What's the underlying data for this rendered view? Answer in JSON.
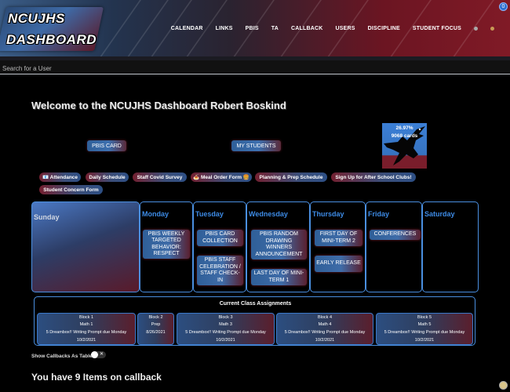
{
  "header": {
    "logo_line1": "NCUJHS",
    "logo_line2": "DASHBOARD",
    "nav": [
      "CALENDAR",
      "LINKS",
      "PBIS",
      "TA",
      "CALLBACK",
      "USERS",
      "DISCIPLINE",
      "STUDENT FOCUS"
    ],
    "corner_badge": "0"
  },
  "search": {
    "placeholder": "Search for a User"
  },
  "welcome": "Welcome to the NCUJHS Dashboard Robert Boskind",
  "buttons": {
    "pbis_card": "PBIS CARD",
    "my_students": "MY STUDENTS"
  },
  "stats": {
    "percent": "26.97%",
    "cards": "9068 cards"
  },
  "pills": [
    "📧 Attendance",
    "Daily Schedule",
    "Staff Covid Survey",
    "🍝 Meal Order Form 🍔",
    "Planning & Prep Schedule",
    "Sign Up for After School Clubs!",
    "Student Concern Form"
  ],
  "calendar": {
    "days": [
      "Sunday",
      "Monday",
      "Tuesday",
      "Wednesday",
      "Thursday",
      "Friday",
      "Saturday"
    ],
    "events": {
      "monday": [
        "PBIS WEEKLY TARGETED BEHAVIOR: RESPECT"
      ],
      "tuesday": [
        "PBIS CARD COLLECTION",
        "PBIS STAFF CELEBRATION / STAFF CHECK-IN"
      ],
      "wednesday": [
        "PBIS RANDOM DRAWING WINNERS ANNOUNCEMENT",
        "LAST DAY OF MINI-TERM 1"
      ],
      "thursday": [
        "FIRST DAY OF MINI-TERM 2",
        "EARLY RELEASE"
      ],
      "friday": [
        "CONFERENCES"
      ]
    }
  },
  "assignments": {
    "title": "Current Class Assignments",
    "blocks": [
      {
        "block": "Block 1",
        "class": "Math 1",
        "assignment": "5 Dreambox!! Writing Prompt due Monday",
        "date": "10/2/2021"
      },
      {
        "block": "Block 2",
        "class": "Prep",
        "assignment": "",
        "date": "8/26/2021"
      },
      {
        "block": "Block 3",
        "class": "Math 3",
        "assignment": "5 Dreambox!! Writing Prompt due Monday",
        "date": "10/2/2021"
      },
      {
        "block": "Block 4",
        "class": "Math 4",
        "assignment": "5 Dreambox!! Writing Prompt due Monday",
        "date": "10/2/2021"
      },
      {
        "block": "Block 5",
        "class": "Math 5",
        "assignment": "5 Dreambox!! Writing Prompt due Monday",
        "date": "10/2/2021"
      }
    ]
  },
  "toggle_label": "Show Callbacks As Table",
  "toggle_x": "✕",
  "callback_text": "You have 9 Items on callback"
}
